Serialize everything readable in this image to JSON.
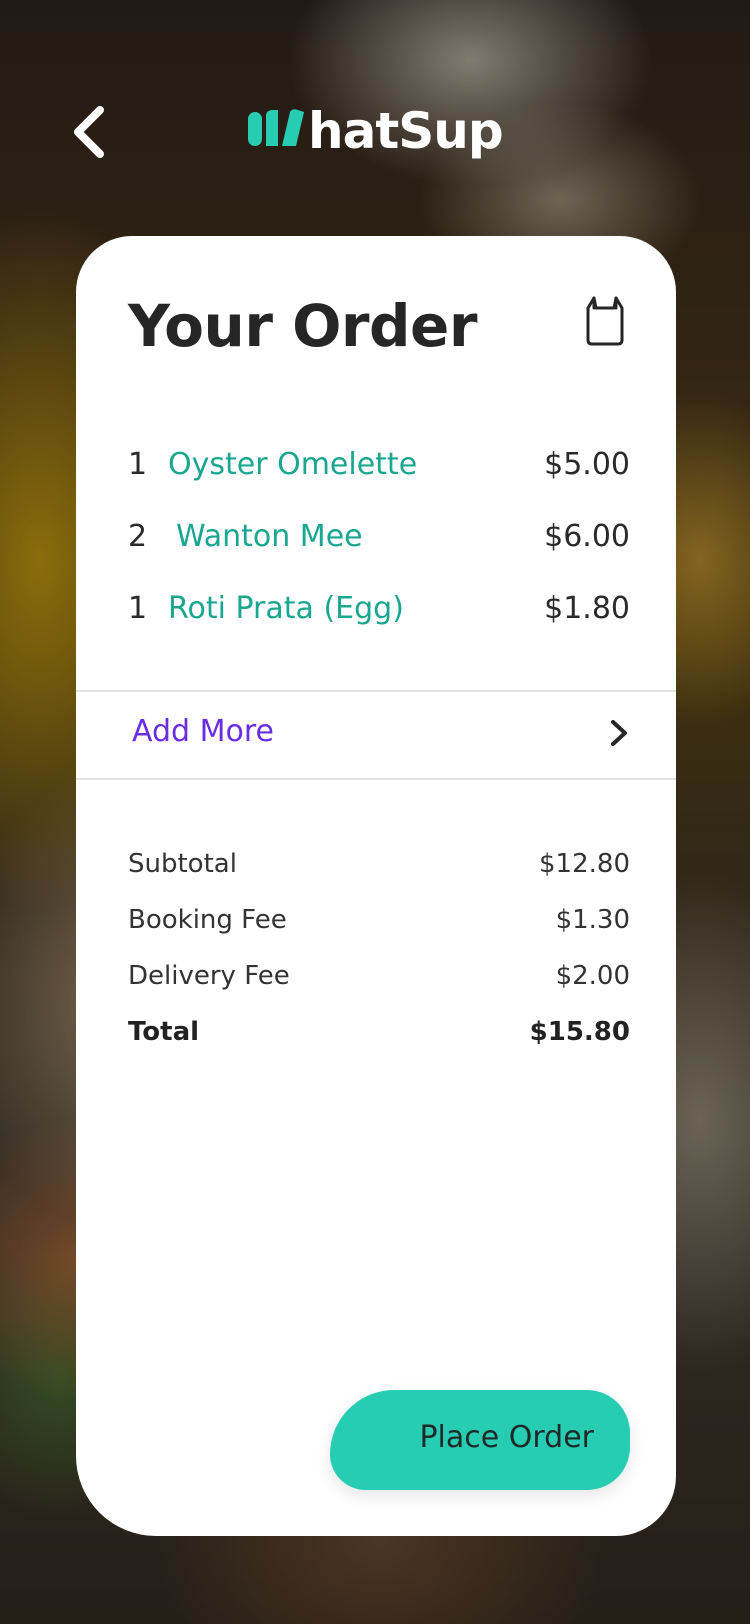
{
  "header": {
    "logo_text": "hatSup",
    "logo_mark_icon": "w-mark-icon",
    "back_icon": "chevron-left-icon"
  },
  "order": {
    "title": "Your Order",
    "bag_icon": "shopping-bag-icon",
    "items": [
      {
        "qty": "1",
        "name": "Oyster Omelette",
        "price": "$5.00"
      },
      {
        "qty": "2",
        "name": "Wanton Mee",
        "price": "$6.00"
      },
      {
        "qty": "1",
        "name": "Roti Prata (Egg)",
        "price": "$1.80"
      }
    ],
    "add_more_label": "Add More",
    "add_more_icon": "chevron-right-icon"
  },
  "summary": {
    "subtotal_label": "Subtotal",
    "subtotal_value": "$12.80",
    "booking_fee_label": "Booking Fee",
    "booking_fee_value": "$1.30",
    "delivery_fee_label": "Delivery Fee",
    "delivery_fee_value": "$2.00",
    "total_label": "Total",
    "total_value": "$15.80"
  },
  "actions": {
    "place_order_label": "Place Order"
  },
  "colors": {
    "accent": "#27cdb3",
    "item_name": "#1aa78f",
    "link": "#6a2ee0"
  }
}
